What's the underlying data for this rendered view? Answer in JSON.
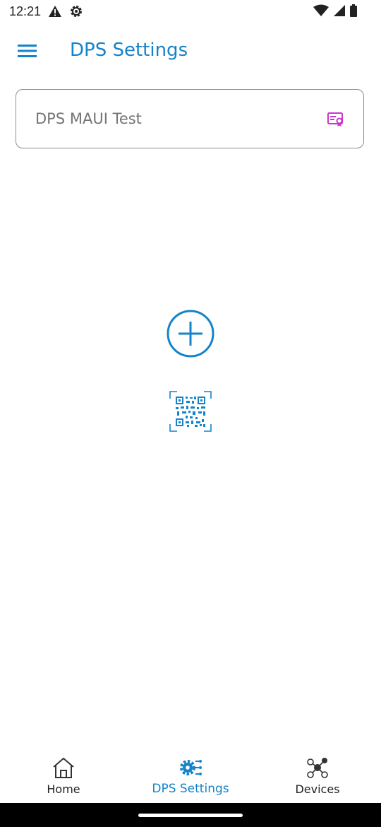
{
  "status_bar": {
    "time": "12:21",
    "left_icons": [
      "alert-icon",
      "settings-gear-icon"
    ],
    "right_icons": [
      "wifi-icon",
      "signal-icon",
      "battery-icon"
    ]
  },
  "app_bar": {
    "title": "DPS Settings",
    "menu_icon": "hamburger-menu-icon"
  },
  "dps_field": {
    "value": "DPS MAUI Test",
    "trailing_icon": "certificate-icon"
  },
  "actions": {
    "add_icon": "add-circle-icon",
    "qr_icon": "qr-scan-icon"
  },
  "bottom_nav": {
    "items": [
      {
        "label": "Home",
        "icon": "home-icon",
        "active": false
      },
      {
        "label": "DPS Settings",
        "icon": "dps-gear-icon",
        "active": true
      },
      {
        "label": "Devices",
        "icon": "devices-icon",
        "active": false
      }
    ]
  },
  "colors": {
    "accent": "#1583c9",
    "cert_icon": "#c837c8",
    "text_muted": "#757575"
  }
}
